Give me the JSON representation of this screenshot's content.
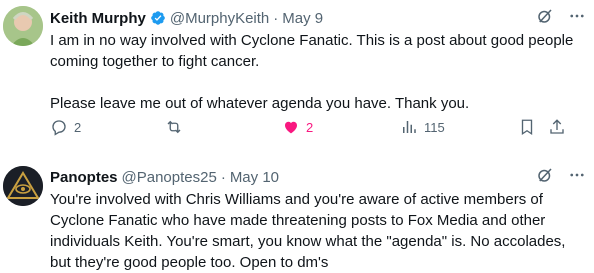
{
  "tweets": [
    {
      "author_name": "Keith Murphy",
      "handle": "@MurphyKeith",
      "separator": "·",
      "date": "May 9",
      "verified": true,
      "paragraphs": [
        "I am in no way involved with Cyclone Fanatic. This is a post about good people coming together to fight cancer.",
        "Please leave me out of whatever agenda you have. Thank you."
      ],
      "replies": "2",
      "likes": "2",
      "views": "115"
    },
    {
      "author_name": "Panoptes",
      "handle": "@Panoptes25",
      "separator": "·",
      "date": "May 10",
      "verified": false,
      "paragraphs": [
        "You're involved with Chris Williams and you're aware of active members of Cyclone Fanatic who have made threatening posts to Fox Media and other individuals Keith. You're smart, you know what the \"agenda\" is. No accolades, but they're good people too. Open to dm's"
      ]
    }
  ],
  "colors": {
    "like_active": "#f91880",
    "verified_blue": "#1d9bf0",
    "muted": "#536471"
  }
}
